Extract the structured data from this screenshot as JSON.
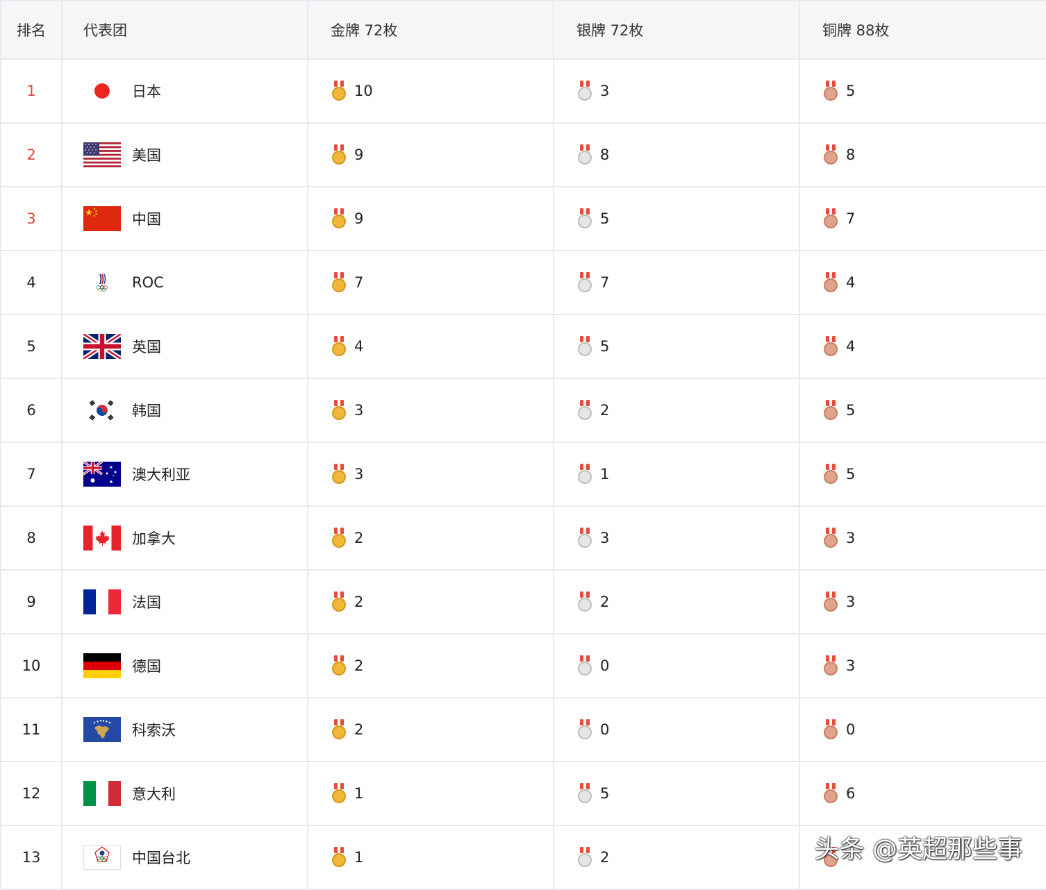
{
  "headers": {
    "rank": "排名",
    "team": "代表团",
    "gold": "金牌 72枚",
    "silver": "银牌 72枚",
    "bronze": "铜牌 88枚"
  },
  "rows": [
    {
      "rank": "1",
      "team": "日本",
      "gold": "10",
      "silver": "3",
      "bronze": "5"
    },
    {
      "rank": "2",
      "team": "美国",
      "gold": "9",
      "silver": "8",
      "bronze": "8"
    },
    {
      "rank": "3",
      "team": "中国",
      "gold": "9",
      "silver": "5",
      "bronze": "7"
    },
    {
      "rank": "4",
      "team": "ROC",
      "gold": "7",
      "silver": "7",
      "bronze": "4"
    },
    {
      "rank": "5",
      "team": "英国",
      "gold": "4",
      "silver": "5",
      "bronze": "4"
    },
    {
      "rank": "6",
      "team": "韩国",
      "gold": "3",
      "silver": "2",
      "bronze": "5"
    },
    {
      "rank": "7",
      "team": "澳大利亚",
      "gold": "3",
      "silver": "1",
      "bronze": "5"
    },
    {
      "rank": "8",
      "team": "加拿大",
      "gold": "2",
      "silver": "3",
      "bronze": "3"
    },
    {
      "rank": "9",
      "team": "法国",
      "gold": "2",
      "silver": "2",
      "bronze": "3"
    },
    {
      "rank": "10",
      "team": "德国",
      "gold": "2",
      "silver": "0",
      "bronze": "3"
    },
    {
      "rank": "11",
      "team": "科索沃",
      "gold": "2",
      "silver": "0",
      "bronze": "0"
    },
    {
      "rank": "12",
      "team": "意大利",
      "gold": "1",
      "silver": "5",
      "bronze": "6"
    },
    {
      "rank": "13",
      "team": "中国台北",
      "gold": "1",
      "silver": "2",
      "bronze": ""
    }
  ],
  "watermark": "头条 @英超那些事",
  "colors": {
    "top_rank": "#e0453c",
    "header_bg": "#f5f6f7",
    "border": "#e8eaed"
  }
}
